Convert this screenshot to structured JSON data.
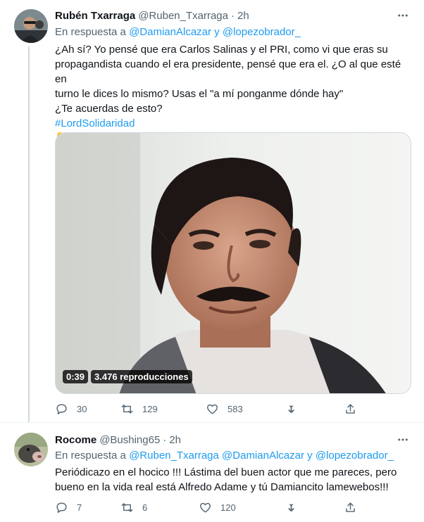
{
  "tweets": [
    {
      "name": "Rubén Txarraga",
      "handle": "@Ruben_Txarraga",
      "separator": "·",
      "time": "2h",
      "reply_prefix": "En respuesta a",
      "reply_mentions": "@DamianAlcazar y @lopezobrador_",
      "text_lines": [
        "¿Ah sí? Yo pensé que era Carlos Salinas y el PRI, como vi que eras su",
        "propagandista cuando el era presidente, pensé que era el. ¿O al que esté en",
        "turno le dices lo mismo? Usas el \"a mí ponganme dónde hay\"",
        "¿Te acuerdas de esto?"
      ],
      "hashtag": "#LordSolidaridad",
      "emoji": "👇👇",
      "video_duration": "0:39",
      "video_views": "3.476 reproducciones",
      "replies": "30",
      "retweets": "129",
      "likes": "583"
    },
    {
      "name": "Rocome",
      "handle": "@Bushing65",
      "separator": "·",
      "time": "2h",
      "reply_prefix": "En respuesta a",
      "reply_mentions": "@Ruben_Txarraga @DamianAlcazar y @lopezobrador_",
      "text_lines": [
        "Periódicazo en el hocico !!! Lástima del buen actor que me pareces, pero",
        "bueno en la vida real está Alfredo Adame y tú Damiancito lamewebos!!!"
      ],
      "replies": "7",
      "retweets": "6",
      "likes": "120"
    }
  ],
  "colors": {
    "link": "#1d9bf0",
    "secondary_text": "#536471",
    "primary_text": "#0f1419",
    "thread_line": "#cfd9de"
  },
  "icons": [
    "more-icon",
    "reply-icon",
    "retweet-icon",
    "like-icon",
    "delete-icon",
    "share-icon",
    "avatar"
  ]
}
